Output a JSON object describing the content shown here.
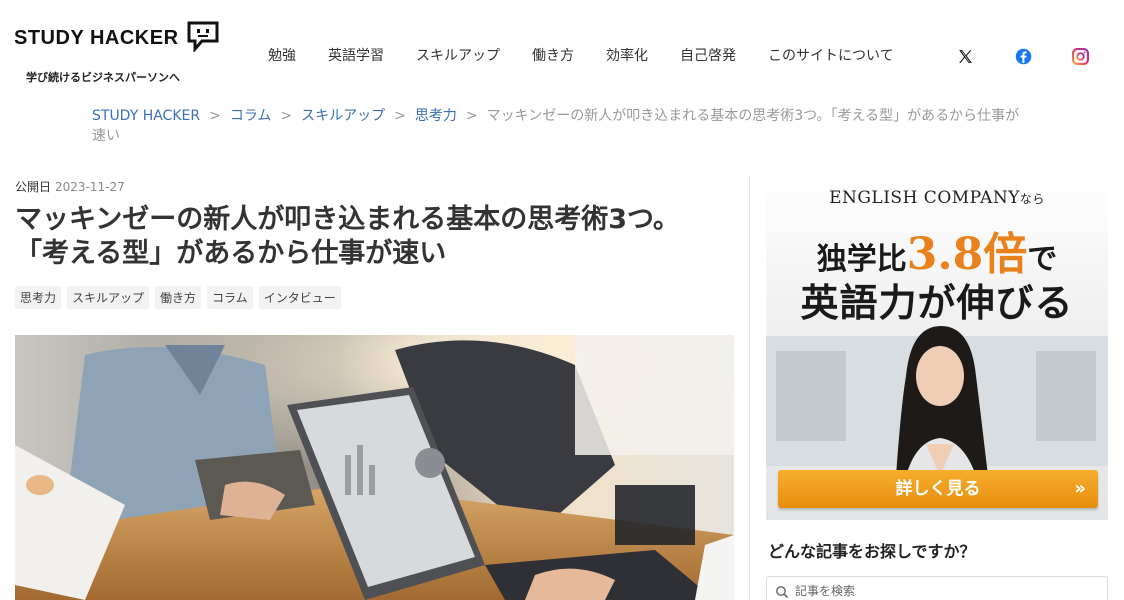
{
  "header": {
    "logo_text": "STUDY HACKER",
    "tagline": "学び続けるビジネスパーソンへ",
    "nav": [
      "勉強",
      "英語学習",
      "スキルアップ",
      "働き方",
      "効率化",
      "自己啓発",
      "このサイトについて"
    ],
    "social_icons": [
      "x-icon",
      "facebook-icon",
      "instagram-icon"
    ]
  },
  "breadcrumb": {
    "items": [
      "STUDY HACKER",
      "コラム",
      "スキルアップ",
      "思考力"
    ],
    "separator": ">",
    "current": "マッキンゼーの新人が叩き込まれる基本の思考術3つ。「考える型」があるから仕事が速い"
  },
  "article": {
    "published_label": "公開日",
    "published_date": "2023-11-27",
    "title_line1": "マッキンゼーの新人が叩き込まれる基本の思考術3つ。",
    "title_line2": "「考える型」があるから仕事が速い",
    "tags": [
      "思考力",
      "スキルアップ",
      "働き方",
      "コラム",
      "インタビュー"
    ]
  },
  "ad": {
    "brand": "ENGLISH COMPANY",
    "brand_suffix": "なら",
    "line1_prefix": "独学比",
    "line1_number": "3.8倍",
    "line1_suffix": "で",
    "line2": "英語力が伸びる",
    "cta": "詳しく見る",
    "cta_arrow": "»"
  },
  "sidebar": {
    "search_heading": "どんな記事をお探しですか？",
    "search_placeholder": "記事を検索"
  },
  "colors": {
    "link": "#3b6fb6",
    "accent_orange": "#e9821d",
    "cta_gradient_top": "#f6ae2d",
    "cta_gradient_bottom": "#e88d0f"
  }
}
